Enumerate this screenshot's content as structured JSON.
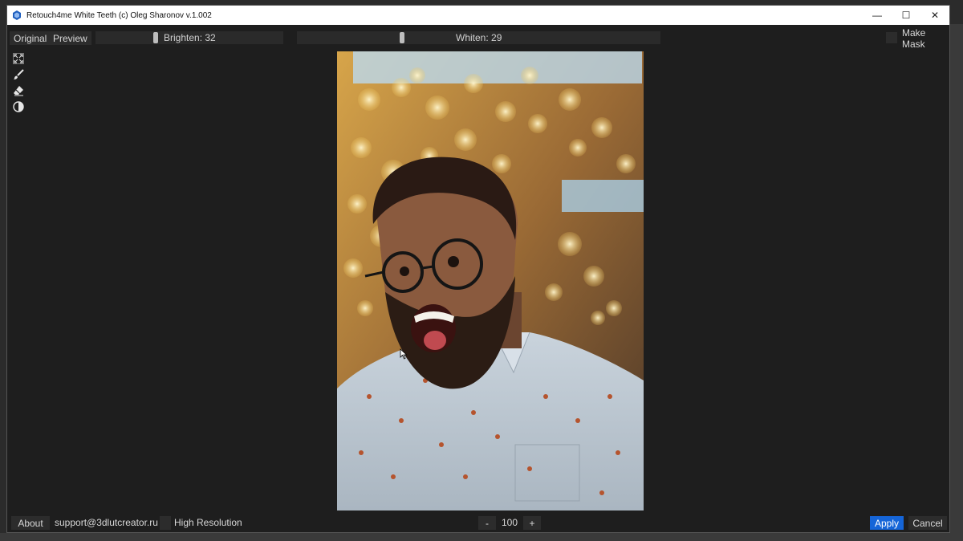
{
  "window": {
    "title": "Retouch4me White Teeth (c) Oleg Sharonov v.1.002",
    "minimize_symbol": "—",
    "maximize_symbol": "☐",
    "close_symbol": "✕"
  },
  "toolbar": {
    "original_label": "Original",
    "preview_label": "Preview",
    "brighten_label": "Brighten: 32",
    "whiten_label": "Whiten: 29",
    "make_mask_label": "Make Mask",
    "brighten_value": 32,
    "whiten_value": 29
  },
  "tools": [
    "fit-screen-icon",
    "brush-icon",
    "eraser-icon",
    "contrast-icon"
  ],
  "bottom": {
    "about_label": "About",
    "support_email": "support@3dlutcreator.ru",
    "high_resolution_label": "High Resolution",
    "zoom_minus": "-",
    "zoom_value": "100",
    "zoom_plus": "+",
    "apply_label": "Apply",
    "cancel_label": "Cancel"
  },
  "colors": {
    "accent": "#1565d8",
    "background": "#1e1e1e",
    "control": "#2c2c2c"
  }
}
